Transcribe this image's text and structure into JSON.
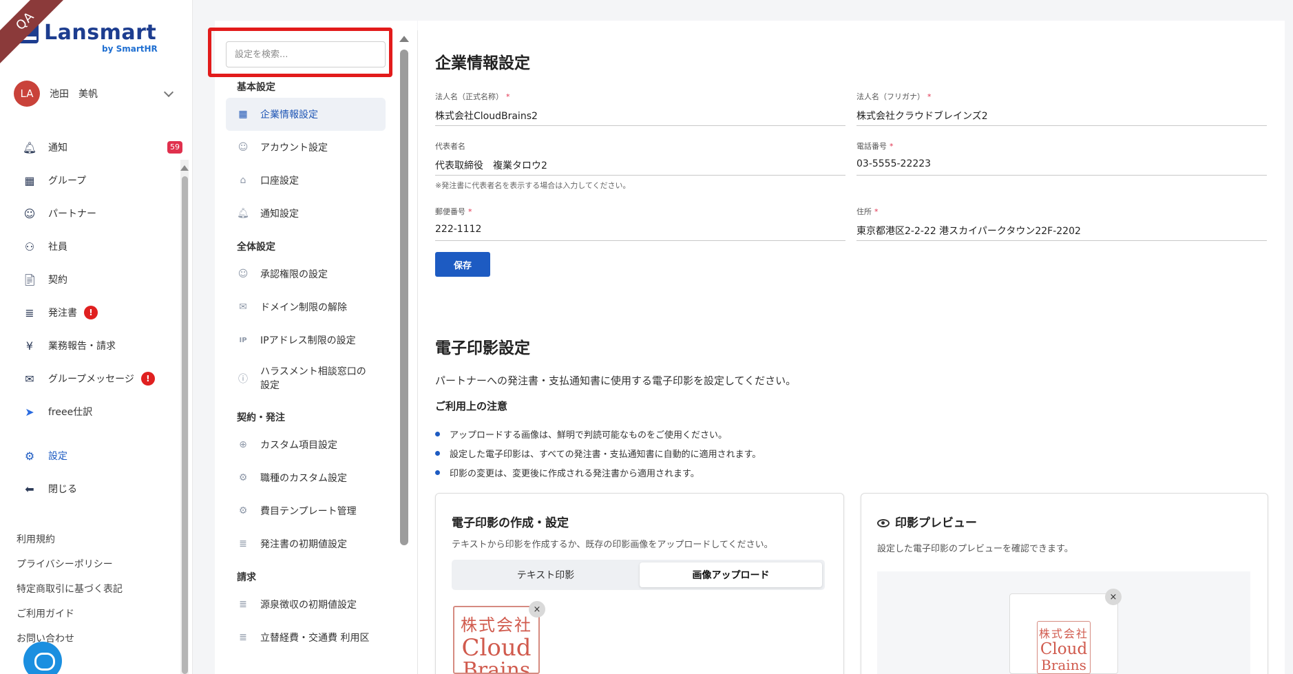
{
  "env_ribbon": "QA",
  "brand": {
    "name": "Lansmart",
    "sub": "by SmartHR"
  },
  "user": {
    "initials": "LA",
    "name": "池田　美帆"
  },
  "nav": {
    "notifications": {
      "label": "通知",
      "count": "59"
    },
    "groups": "グループ",
    "partners": "パートナー",
    "employees": "社員",
    "contracts": "契約",
    "orders": {
      "label": "発注書",
      "badge": "!"
    },
    "reports": "業務報告・請求",
    "group_messages": {
      "label": "グループメッセージ",
      "badge": "!"
    },
    "freee": "freee仕訳",
    "settings": "設定",
    "close": "閉じる"
  },
  "footer_links": [
    "利用規約",
    "プライバシーポリシー",
    "特定商取引に基づく表記",
    "ご利用ガイド",
    "お問い合わせ"
  ],
  "settings_panel": {
    "search_placeholder": "設定を検索...",
    "groups": {
      "basic": "基本設定",
      "overall": "全体設定",
      "contract": "契約・発注",
      "billing": "請求"
    },
    "items": {
      "company": "企業情報設定",
      "account": "アカウント設定",
      "bank": "口座設定",
      "notify": "通知設定",
      "approval": "承認権限の設定",
      "domain": "ドメイン制限の解除",
      "ip": "IPアドレス制限の設定",
      "harassment": "ハラスメント相談窓口の設定",
      "custom_fields": "カスタム項目設定",
      "job_custom": "職種のカスタム設定",
      "expense_template": "費目テンプレート管理",
      "order_defaults": "発注書の初期値設定",
      "withholding": "源泉徴収の初期値設定",
      "travel": "立替経費・交通費 利用区"
    }
  },
  "company_info": {
    "title": "企業情報設定",
    "legal_name": {
      "label": "法人名（正式名称）",
      "value": "株式会社CloudBrains2"
    },
    "legal_name_kana": {
      "label": "法人名（フリガナ）",
      "value": "株式会社クラウドブレインズ2"
    },
    "representative": {
      "label": "代表者名",
      "value": "代表取締役　複業タロウ2",
      "hint": "※発注書に代表者名を表示する場合は入力してください。"
    },
    "phone": {
      "label": "電話番号",
      "value": "03-5555-22223"
    },
    "postal": {
      "label": "郵便番号",
      "value": "222-1112"
    },
    "address": {
      "label": "住所",
      "value": "東京都港区2-2-22 港スカイパークタウン22F-2202"
    },
    "save": "保存",
    "required_mark": "*"
  },
  "seal": {
    "title": "電子印影設定",
    "description": "パートナーへの発注書・支払通知書に使用する電子印影を設定してください。",
    "notes_title": "ご利用上の注意",
    "notes": [
      "アップロードする画像は、鮮明で判読可能なものをご使用ください。",
      "設定した電子印影は、すべての発注書・支払通知書に自動的に適用されます。",
      "印影の変更は、変更後に作成される発注書から適用されます。"
    ],
    "create_card": {
      "title": "電子印影の作成・設定",
      "desc": "テキストから印影を作成するか、既存の印影画像をアップロードしてください。",
      "tab_text": "テキスト印影",
      "tab_upload": "画像アップロード"
    },
    "preview_card": {
      "title": "印影プレビュー",
      "desc": "設定した電子印影のプレビューを確認できます。"
    },
    "stamp_text": {
      "line1": "株式会社",
      "line2": "Cloud",
      "line3": "Brains"
    },
    "remove": "×"
  },
  "colors": {
    "primary": "#1d5bc2",
    "brand": "#1d3d8f",
    "alert": "#e0304d",
    "highlight": "#e21b1b"
  }
}
